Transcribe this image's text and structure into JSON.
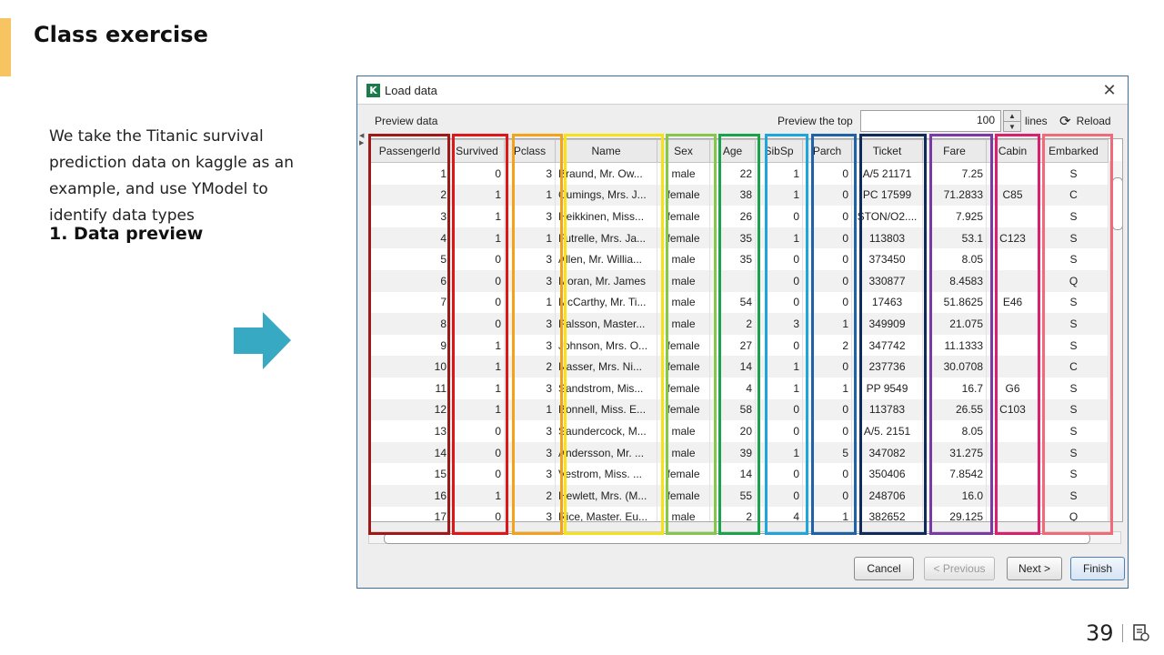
{
  "slide": {
    "title": "Class exercise",
    "paragraph": "We take the Titanic survival prediction data on kaggle as an example, and use YModel to identify data types",
    "step": "1. Data preview",
    "page_number": "39"
  },
  "dialog": {
    "title": "Load data",
    "app_icon_letter": "K",
    "close": "✕",
    "preview_label": "Preview data",
    "top_label": "Preview the top",
    "top_value": "100",
    "lines_label": "lines",
    "reload_label": "Reload",
    "buttons": {
      "cancel": "Cancel",
      "previous": "< Previous",
      "next": "Next >",
      "finish": "Finish"
    }
  },
  "table": {
    "columns": [
      "PassengerId",
      "Survived",
      "Pclass",
      "Name",
      "Sex",
      "Age",
      "SibSp",
      "Parch",
      "Ticket",
      "Fare",
      "Cabin",
      "Embarked"
    ],
    "rows": [
      [
        "1",
        "0",
        "3",
        "Braund, Mr. Ow...",
        "male",
        "22",
        "1",
        "0",
        "A/5 21171",
        "7.25",
        "",
        "S"
      ],
      [
        "2",
        "1",
        "1",
        "Cumings, Mrs. J...",
        "female",
        "38",
        "1",
        "0",
        "PC 17599",
        "71.2833",
        "C85",
        "C"
      ],
      [
        "3",
        "1",
        "3",
        "Heikkinen, Miss...",
        "female",
        "26",
        "0",
        "0",
        "STON/O2....",
        "7.925",
        "",
        "S"
      ],
      [
        "4",
        "1",
        "1",
        "Futrelle, Mrs. Ja...",
        "female",
        "35",
        "1",
        "0",
        "113803",
        "53.1",
        "C123",
        "S"
      ],
      [
        "5",
        "0",
        "3",
        "Allen, Mr. Willia...",
        "male",
        "35",
        "0",
        "0",
        "373450",
        "8.05",
        "",
        "S"
      ],
      [
        "6",
        "0",
        "3",
        "Moran, Mr. James",
        "male",
        "",
        "0",
        "0",
        "330877",
        "8.4583",
        "",
        "Q"
      ],
      [
        "7",
        "0",
        "1",
        "McCarthy, Mr. Ti...",
        "male",
        "54",
        "0",
        "0",
        "17463",
        "51.8625",
        "E46",
        "S"
      ],
      [
        "8",
        "0",
        "3",
        "Palsson, Master...",
        "male",
        "2",
        "3",
        "1",
        "349909",
        "21.075",
        "",
        "S"
      ],
      [
        "9",
        "1",
        "3",
        "Johnson, Mrs. O...",
        "female",
        "27",
        "0",
        "2",
        "347742",
        "11.1333",
        "",
        "S"
      ],
      [
        "10",
        "1",
        "2",
        "Nasser, Mrs. Ni...",
        "female",
        "14",
        "1",
        "0",
        "237736",
        "30.0708",
        "",
        "C"
      ],
      [
        "11",
        "1",
        "3",
        "Sandstrom, Mis...",
        "female",
        "4",
        "1",
        "1",
        "PP 9549",
        "16.7",
        "G6",
        "S"
      ],
      [
        "12",
        "1",
        "1",
        "Bonnell, Miss. E...",
        "female",
        "58",
        "0",
        "0",
        "113783",
        "26.55",
        "C103",
        "S"
      ],
      [
        "13",
        "0",
        "3",
        "Saundercock, M...",
        "male",
        "20",
        "0",
        "0",
        "A/5. 2151",
        "8.05",
        "",
        "S"
      ],
      [
        "14",
        "0",
        "3",
        "Andersson, Mr. ...",
        "male",
        "39",
        "1",
        "5",
        "347082",
        "31.275",
        "",
        "S"
      ],
      [
        "15",
        "0",
        "3",
        "Vestrom, Miss. ...",
        "female",
        "14",
        "0",
        "0",
        "350406",
        "7.8542",
        "",
        "S"
      ],
      [
        "16",
        "1",
        "2",
        "Hewlett, Mrs. (M...",
        "female",
        "55",
        "0",
        "0",
        "248706",
        "16.0",
        "",
        "S"
      ],
      [
        "17",
        "0",
        "3",
        "Rice, Master. Eu...",
        "male",
        "2",
        "4",
        "1",
        "382652",
        "29.125",
        "",
        "Q"
      ]
    ]
  },
  "column_highlight_colors": [
    "#a01818",
    "#e01515",
    "#f3a21a",
    "#f5e318",
    "#86c64a",
    "#1aa34a",
    "#1ea6dc",
    "#2062a6",
    "#102a5c",
    "#7a3aa6",
    "#d8206e",
    "#f06a7a"
  ],
  "colors": {
    "accent": "#f7c462",
    "arrow": "#38a9c2"
  }
}
